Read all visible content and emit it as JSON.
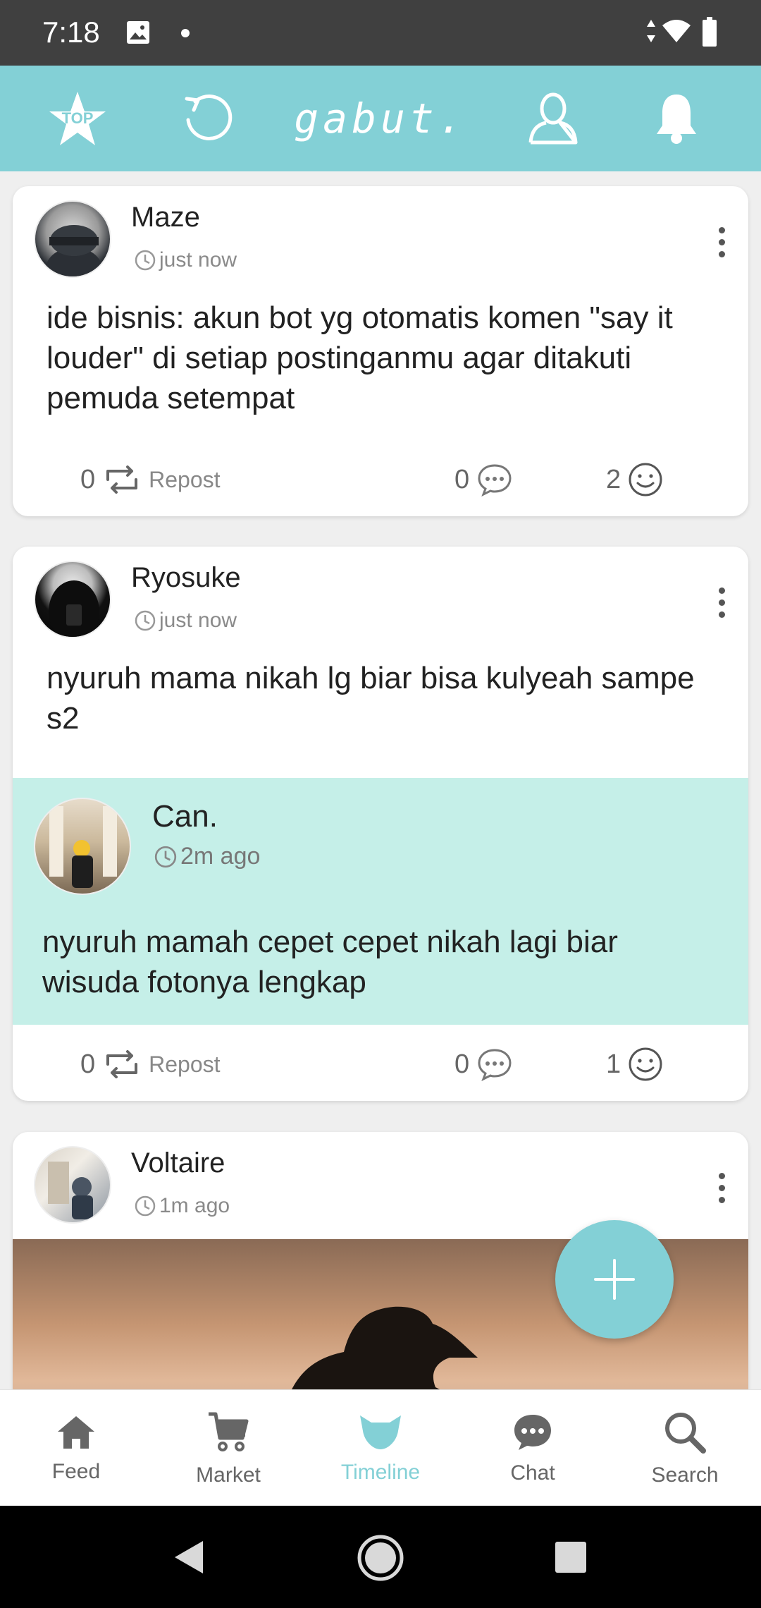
{
  "status_bar": {
    "time": "7:18"
  },
  "app_bar": {
    "brand": "gabut.",
    "top_badge": "TOP"
  },
  "posts": [
    {
      "user": "Maze",
      "time": "just now",
      "text": "ide bisnis: akun bot yg otomatis komen \"say it louder\" di setiap postinganmu agar ditakuti pemuda setempat",
      "repost_count": "0",
      "repost_label": "Repost",
      "comment_count": "0",
      "reaction_count": "2"
    },
    {
      "user": "Ryosuke",
      "time": "just now",
      "text": "nyuruh mama nikah lg biar bisa kulyeah sampe s2",
      "quoted": {
        "user": "Can.",
        "time": "2m ago",
        "text": "nyuruh mamah cepet cepet nikah lagi biar wisuda fotonya lengkap"
      },
      "repost_count": "0",
      "repost_label": "Repost",
      "comment_count": "0",
      "reaction_count": "1"
    },
    {
      "user": "Voltaire",
      "time": "1m ago"
    }
  ],
  "bottom_nav": [
    {
      "label": "Feed",
      "icon": "home-icon"
    },
    {
      "label": "Market",
      "icon": "cart-icon"
    },
    {
      "label": "Timeline",
      "icon": "fox-icon",
      "active": true
    },
    {
      "label": "Chat",
      "icon": "chat-bubble-icon"
    },
    {
      "label": "Search",
      "icon": "search-icon"
    }
  ],
  "colors": {
    "accent": "#83d0d6",
    "quote_bg": "#c5efe8",
    "status_bar": "#404040"
  }
}
